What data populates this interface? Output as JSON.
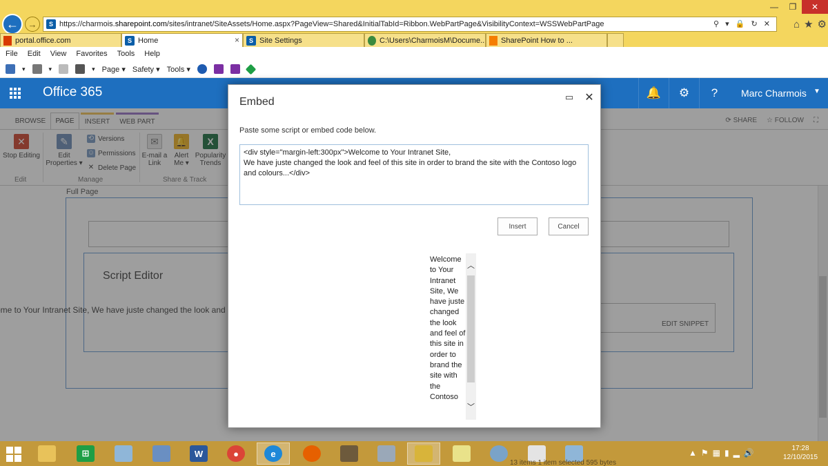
{
  "browser": {
    "url_prefix": "https://charmois.",
    "url_domain": "sharepoint.com",
    "url_path": "/sites/intranet/SiteAssets/Home.aspx?PageView=Shared&InitialTabId=Ribbon.WebPartPage&VisibilityContext=WSSWebPartPage",
    "tabs": [
      {
        "label": "portal.office.com"
      },
      {
        "label": "Home",
        "close": "×"
      },
      {
        "label": "Site Settings"
      },
      {
        "label": "C:\\Users\\CharmoisM\\Docume..."
      },
      {
        "label": "SharePoint How to ..."
      }
    ],
    "menu": [
      "File",
      "Edit",
      "View",
      "Favorites",
      "Tools",
      "Help"
    ],
    "command_bar": {
      "page": "Page ▾",
      "safety": "Safety ▾",
      "tools": "Tools ▾"
    }
  },
  "suite": {
    "brand": "Office 365",
    "user": "Marc Charmois"
  },
  "ribbon": {
    "tabs": [
      "BROWSE",
      "PAGE",
      "INSERT",
      "WEB PART"
    ],
    "share": "SHARE",
    "follow": "FOLLOW",
    "stop_editing": "Stop Editing",
    "edit_properties_1": "Edit",
    "edit_properties_2": "Properties ▾",
    "versions": "Versions",
    "permissions": "Permissions",
    "delete_page": "Delete Page",
    "email_link_1": "E-mail a",
    "email_link_2": "Link",
    "alert_me_1": "Alert",
    "alert_me_2": "Me ▾",
    "popularity_1": "Popularity",
    "popularity_2": "Trends",
    "groups": {
      "edit": "Edit",
      "manage": "Manage",
      "share_track": "Share & Track"
    }
  },
  "page": {
    "zone_label": "Full Page",
    "script_editor_title": "Script Editor",
    "script_output": "ome to Your Intranet Site, We have juste changed the look and feel of this site in order to brand the site with the Contoso logo and colours...",
    "edit_snippet": "EDIT SNIPPET"
  },
  "dialog": {
    "title": "Embed",
    "prompt": "Paste some script or embed code below.",
    "code": "<div style=\"margin-left:300px\">Welcome to Your Intranet Site,\nWe have juste changed the look and feel of this site in order to brand the site with the Contoso logo and colours...</div>",
    "insert_label": "Insert",
    "cancel_label": "Cancel",
    "preview_text": "Welcome to Your Intranet Site, We have juste changed the look and feel of this site in order to brand the site with the Contoso"
  },
  "taskbar": {
    "status_text": "13 items     1 item selected  595 bytes",
    "clock_time": "17:28",
    "clock_date": "12/10/2015"
  },
  "colors": {
    "suite_bar": "#1e6fbf",
    "chrome": "#f4d65e",
    "taskbar": "#c3993b"
  }
}
